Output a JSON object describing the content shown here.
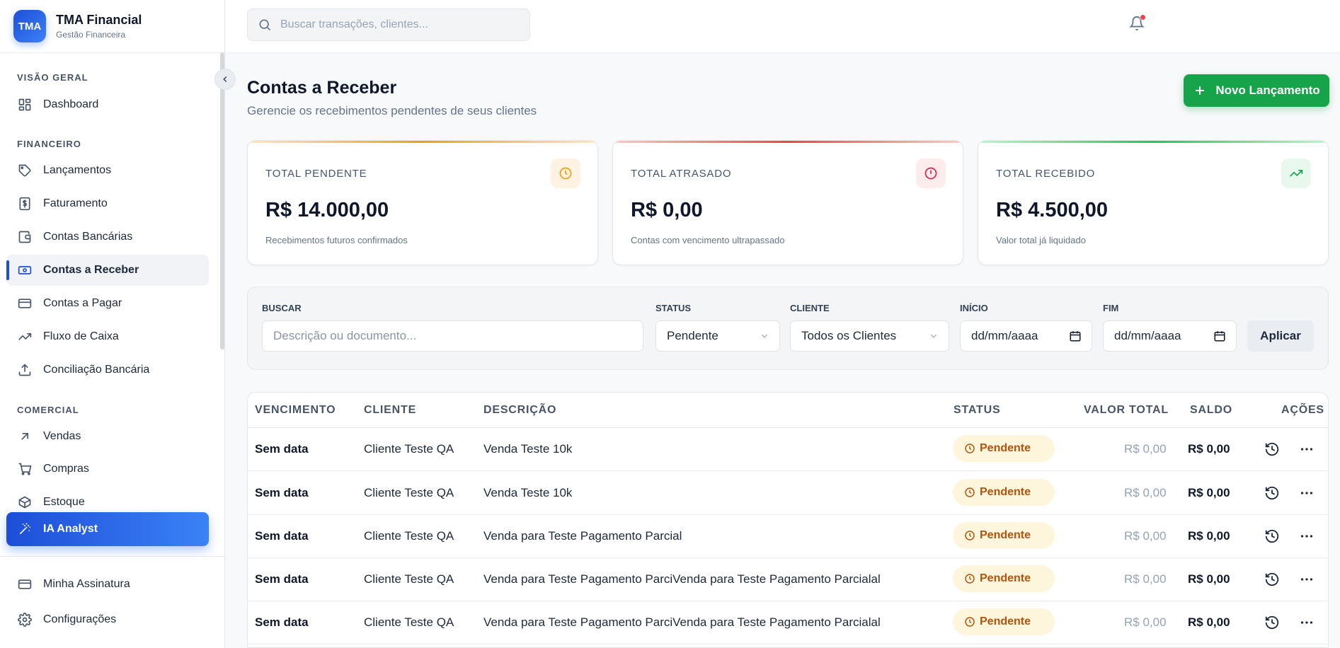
{
  "brand": {
    "logo": "TMA",
    "name": "TMA Financial",
    "subtitle": "Gestão Financeira"
  },
  "sidebar": {
    "sections": [
      {
        "title": "VISÃO GERAL"
      },
      {
        "title": "FINANCEIRO"
      },
      {
        "title": "COMERCIAL"
      }
    ],
    "items": [
      {
        "label": "Dashboard",
        "icon": "grid-icon"
      },
      {
        "label": "Lançamentos",
        "icon": "tag-icon"
      },
      {
        "label": "Faturamento",
        "icon": "invoice-dollar-icon"
      },
      {
        "label": "Contas Bancárias",
        "icon": "wallet-icon"
      },
      {
        "label": "Contas a Receber",
        "icon": "banknote-icon",
        "active": true
      },
      {
        "label": "Contas a Pagar",
        "icon": "credit-card-icon"
      },
      {
        "label": "Fluxo de Caixa",
        "icon": "trending-up-icon"
      },
      {
        "label": "Conciliação Bancária",
        "icon": "upload-icon"
      },
      {
        "label": "Vendas",
        "icon": "arrow-up-right-icon"
      },
      {
        "label": "Compras",
        "icon": "cart-icon"
      },
      {
        "label": "Estoque",
        "icon": "box-icon"
      },
      {
        "label": "IA Analyst",
        "icon": "magic-wand-icon",
        "highlight": true
      },
      {
        "label": "Minha Assinatura",
        "icon": "credit-card-icon"
      },
      {
        "label": "Configurações",
        "icon": "gear-icon"
      }
    ]
  },
  "topbar": {
    "search_placeholder": "Buscar transações, clientes...",
    "notification_dot_color": "#ef4444"
  },
  "page": {
    "title": "Contas a Receber",
    "subtitle": "Gerencie os recebimentos pendentes de seus clientes",
    "new_button": "Novo Lançamento"
  },
  "cards": [
    {
      "label": "TOTAL PENDENTE",
      "value": "R$ 14.000,00",
      "note": "Recebimentos futuros confirmados",
      "icon": "clock-icon",
      "accent": "#f59e0b"
    },
    {
      "label": "TOTAL ATRASADO",
      "value": "R$ 0,00",
      "note": "Contas com vencimento ultrapassado",
      "icon": "alert-circle-icon",
      "accent": "#ef4444"
    },
    {
      "label": "TOTAL RECEBIDO",
      "value": "R$ 4.500,00",
      "note": "Valor total já liquidado",
      "icon": "trending-up-icon",
      "accent": "#22c55e"
    }
  ],
  "filters": {
    "search_label": "BUSCAR",
    "search_placeholder": "Descrição ou documento...",
    "status_label": "STATUS",
    "status_value": "Pendente",
    "client_label": "CLIENTE",
    "client_value": "Todos os Clientes",
    "start_label": "INÍCIO",
    "start_placeholder": "dd/mm/aaaa",
    "end_label": "FIM",
    "end_placeholder": "dd/mm/aaaa",
    "apply_label": "Aplicar"
  },
  "table": {
    "columns": [
      "VENCIMENTO",
      "CLIENTE",
      "DESCRIÇÃO",
      "STATUS",
      "VALOR TOTAL",
      "SALDO",
      "AÇÕES"
    ],
    "rows": [
      {
        "due": "Sem data",
        "client": "Cliente Teste QA",
        "description": "Venda Teste 10k",
        "status": "Pendente",
        "total": "R$ 0,00",
        "balance": "R$ 0,00"
      },
      {
        "due": "Sem data",
        "client": "Cliente Teste QA",
        "description": "Venda Teste 10k",
        "status": "Pendente",
        "total": "R$ 0,00",
        "balance": "R$ 0,00"
      },
      {
        "due": "Sem data",
        "client": "Cliente Teste QA",
        "description": "Venda para Teste Pagamento Parcial",
        "status": "Pendente",
        "total": "R$ 0,00",
        "balance": "R$ 0,00"
      },
      {
        "due": "Sem data",
        "client": "Cliente Teste QA",
        "description": "Venda para Teste Pagamento ParciVenda para Teste Pagamento Parcialal",
        "status": "Pendente",
        "total": "R$ 0,00",
        "balance": "R$ 0,00"
      },
      {
        "due": "Sem data",
        "client": "Cliente Teste QA",
        "description": "Venda para Teste Pagamento ParciVenda para Teste Pagamento Parcialal",
        "status": "Pendente",
        "total": "R$ 0,00",
        "balance": "R$ 0,00"
      }
    ]
  }
}
